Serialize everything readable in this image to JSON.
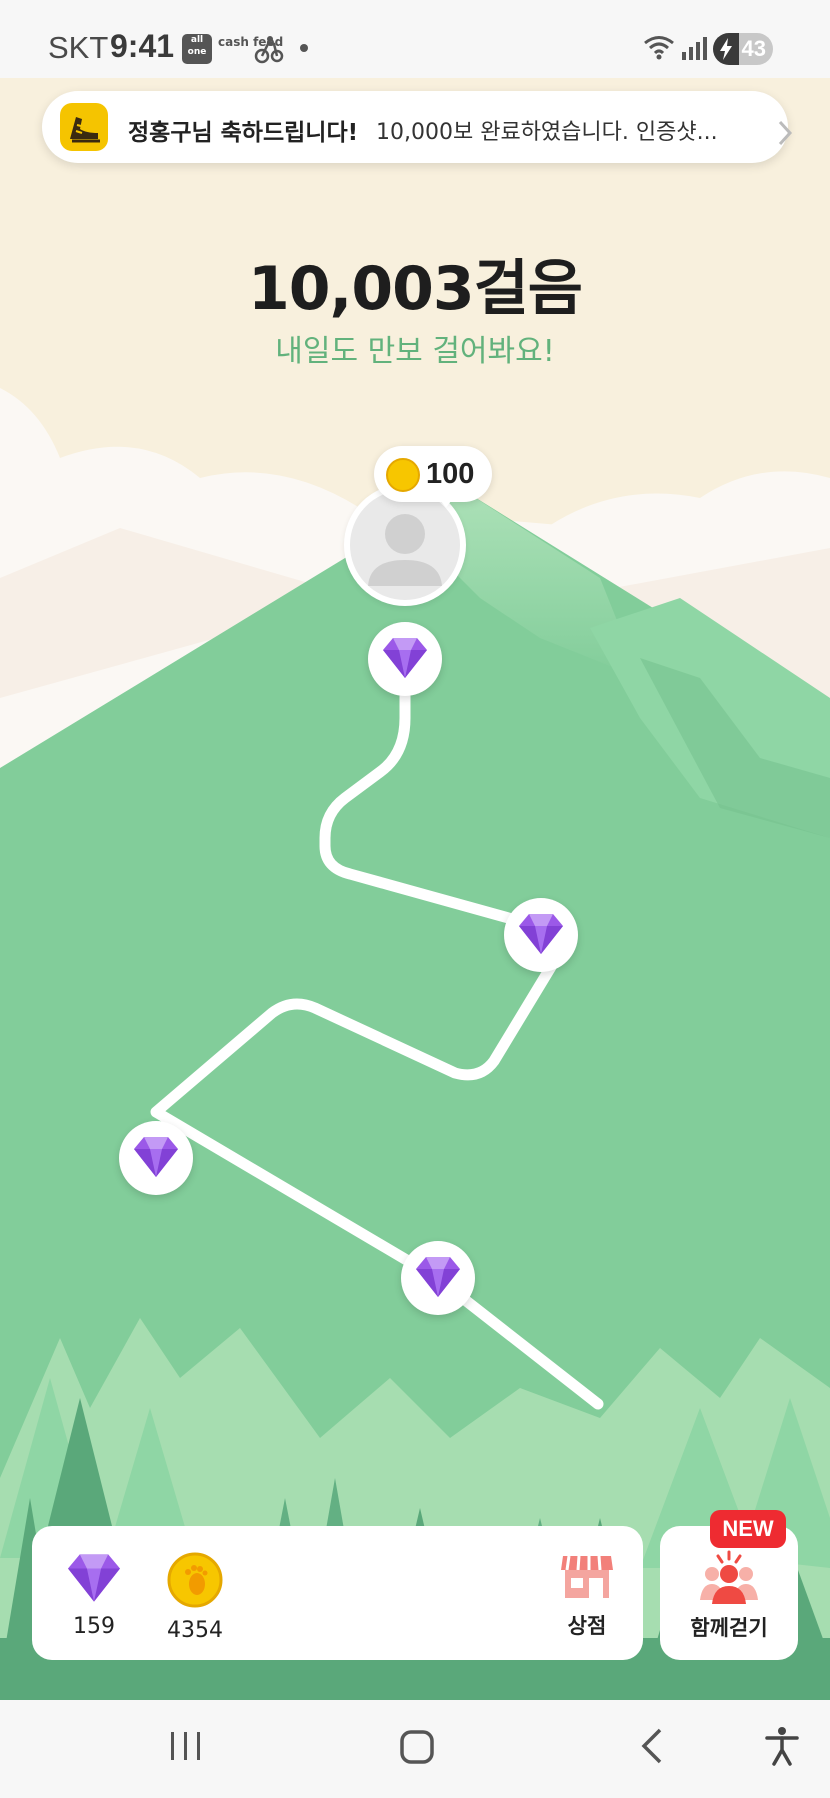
{
  "status_bar": {
    "carrier": "SKT",
    "time": "9:41",
    "app_icon_1_text": "all one",
    "app_icon_2_text": "cash feed",
    "battery": "43",
    "battery_level": 0.43
  },
  "notification": {
    "title": "정홍구님 축하드립니다!",
    "body": "10,000보 완료하였습니다. 인증샷..."
  },
  "main": {
    "steps": "10,003걸음",
    "subtitle": "내일도 만보 걸어봐요!"
  },
  "summit": {
    "reward": "100",
    "avatar_icon": "default-user-avatar"
  },
  "path_nodes": [
    {
      "icon": "gem-icon"
    },
    {
      "icon": "gem-icon"
    },
    {
      "icon": "gem-icon"
    },
    {
      "icon": "gem-icon"
    }
  ],
  "bottom": {
    "gems": "159",
    "coins": "4354",
    "shop_label": "상점",
    "walk_together_label": "함께걷기",
    "new_badge": "NEW"
  },
  "colors": {
    "mountain": "#82cd9a",
    "path": "#ffffff",
    "gem": "#9b59e8",
    "coin": "#f7c600",
    "subtitle": "#62b27c",
    "badge": "#ee2b31"
  },
  "nav": {
    "icons": [
      "recents-icon",
      "home-icon",
      "back-icon",
      "accessibility-icon"
    ]
  }
}
